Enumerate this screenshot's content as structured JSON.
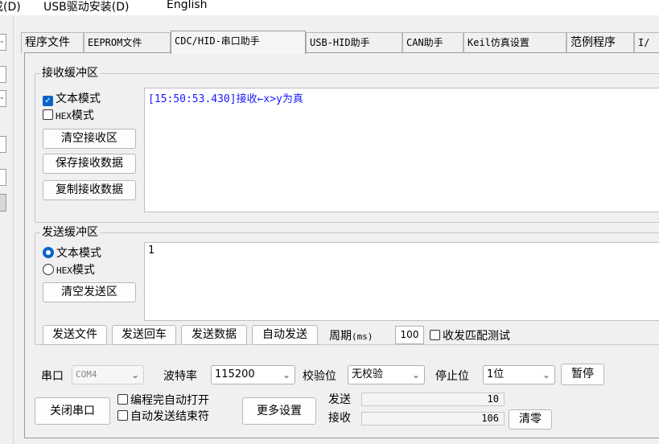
{
  "menu": {
    "items": [
      {
        "label": "成(D)",
        "underline": "D"
      },
      {
        "label": "USB驱动安装(D)",
        "underline": "D"
      },
      {
        "label": "English",
        "underline": "E"
      }
    ]
  },
  "tabs": [
    "程序文件",
    "EEPROM文件",
    "CDC/HID-串口助手",
    "USB-HID助手",
    "CAN助手",
    "Keil仿真设置",
    "范例程序",
    "I/"
  ],
  "active_tab": "CDC/HID-串口助手",
  "receive": {
    "group_title": "接收缓冲区",
    "text_mode_label": "文本模式",
    "text_mode_checked": true,
    "hex_prefix": "HEX",
    "hex_suffix": "模式",
    "hex_mode_checked": false,
    "clear_label": "清空接收区",
    "save_label": "保存接收数据",
    "copy_label": "复制接收数据",
    "content": "[15:50:53.430]接收←x>y为真",
    "content_color": "#1a1aff"
  },
  "send": {
    "group_title": "发送缓冲区",
    "text_mode_label": "文本模式",
    "text_mode_selected": true,
    "hex_prefix": "HEX",
    "hex_suffix": "模式",
    "clear_label": "清空发送区",
    "content": "1"
  },
  "actions": {
    "send_file": "发送文件",
    "send_enter": "发送回车",
    "send_data": "发送数据",
    "auto_send": "自动发送",
    "period_label": "周期",
    "period_unit": "(ms)",
    "period_value": "100",
    "match_test_label": "收发匹配测试"
  },
  "serial": {
    "port_label": "串口",
    "port_value": "COM4",
    "baud_label": "波特率",
    "baud_value": "115200",
    "parity_label": "校验位",
    "parity_value": "无校验",
    "stop_label": "停止位",
    "stop_value": "1位",
    "pause_label": "暂停",
    "close_label": "关闭串口",
    "auto_open_label": "编程完自动打开",
    "auto_close_label": "自动发送结束符",
    "more_label": "更多设置",
    "send_count_label": "发送",
    "send_count": "10",
    "recv_count_label": "接收",
    "recv_count": "106",
    "reset_label": "清零"
  },
  "colors": {
    "accent": "#0a63c9",
    "receive_text": "#1a1aff"
  }
}
